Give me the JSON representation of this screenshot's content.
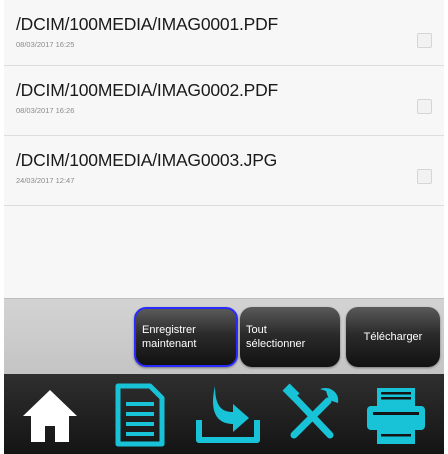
{
  "files": [
    {
      "path": "/DCIM/100MEDIA/IMAG0001.PDF",
      "date": "08/03/2017 16:25"
    },
    {
      "path": "/DCIM/100MEDIA/IMAG0002.PDF",
      "date": "08/03/2017 16:26"
    },
    {
      "path": "/DCIM/100MEDIA/IMAG0003.JPG",
      "date": "24/03/2017 12:47"
    }
  ],
  "buttons": {
    "save_line1": "Enregistrer",
    "save_line2": "maintenant",
    "select_all_line1": "Tout",
    "select_all_line2": "sélectionner",
    "download": "Télécharger"
  },
  "nav": {
    "icons": [
      "home-icon",
      "document-icon",
      "download-tray-icon",
      "tools-icon",
      "scanner-icon"
    ]
  },
  "colors": {
    "nav_icon": "#18c3d8",
    "home_icon": "#ffffff",
    "save_highlight": "#2a2aff",
    "button_bg": "#222222"
  }
}
